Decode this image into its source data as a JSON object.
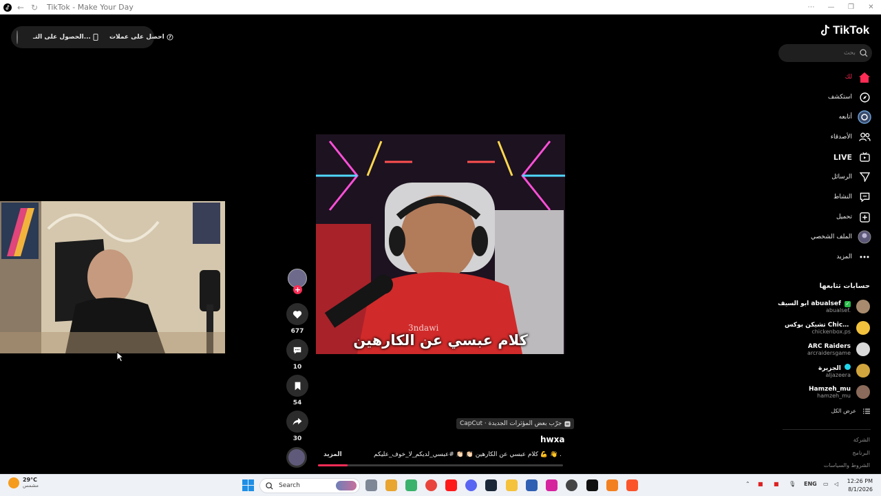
{
  "window": {
    "title": "TikTok - Make Your Day"
  },
  "topbar": {
    "item_coins": "احصل على عملات",
    "item_app": "الحصول على التـ..."
  },
  "brand": {
    "name": "TikTok"
  },
  "search": {
    "placeholder": "بحث"
  },
  "nav": {
    "items": [
      {
        "label": "لك",
        "icon": "home-icon",
        "active": true
      },
      {
        "label": "استكشف",
        "icon": "compass-icon"
      },
      {
        "label": "أتابعه",
        "icon": "following-avatar-icon"
      },
      {
        "label": "الأصدقاء",
        "icon": "friends-icon"
      },
      {
        "label": "LIVE",
        "icon": "live-tv-icon"
      },
      {
        "label": "الرسائل",
        "icon": "messages-icon"
      },
      {
        "label": "النشاط",
        "icon": "activity-icon"
      },
      {
        "label": "تحميل",
        "icon": "upload-icon"
      },
      {
        "label": "الملف الشخصي",
        "icon": "profile-avatar-icon"
      },
      {
        "label": "المزيد",
        "icon": "more-icon"
      }
    ]
  },
  "following": {
    "title": "حسابات تتابعها",
    "accounts": [
      {
        "name": "ابو السيف abualsef",
        "handle": "abualsef.",
        "color": "#a88b6e",
        "verified": true
      },
      {
        "name": "تشيكن بوكس Chicken Box",
        "handle": "chickenbox.ps",
        "color": "#f2c23c"
      },
      {
        "name": "ARC Raiders",
        "handle": "arcraidersgame",
        "color": "#d9d9d9"
      },
      {
        "name": "الجزيرة",
        "handle": "aljazeera",
        "color": "#d1a53d",
        "verified": true
      },
      {
        "name": "Hamzeh_mu",
        "handle": "hamzeh_mu",
        "color": "#8a6a5a"
      }
    ],
    "see_all": "عرض الكل"
  },
  "footer": {
    "links": [
      "الشركة",
      "البرنامج",
      "الشروط والسياسات"
    ]
  },
  "video": {
    "caption_overlay": "كلام عبسي عن الكارهين",
    "watermark": "3ndawi",
    "capcut_chip": "CapCut · جرّب بعض المؤثرات الجديدة",
    "author": "hwxa",
    "description": "كلام عبسي عن الكارهين 👏🏻 👏🏻 #عبسي_لديكم_لا_خوف_عليكم 💪 👋 ...",
    "more": "المزيد",
    "progress": 0.12
  },
  "actions": {
    "likes": "677",
    "comments": "10",
    "saves": "54",
    "shares": "30"
  },
  "taskbar": {
    "weather_temp": "29°C",
    "weather_desc": "مشمس",
    "search_label": "Search",
    "language": "ENG",
    "time": "12:26 PM",
    "date": "8/1/2026"
  }
}
